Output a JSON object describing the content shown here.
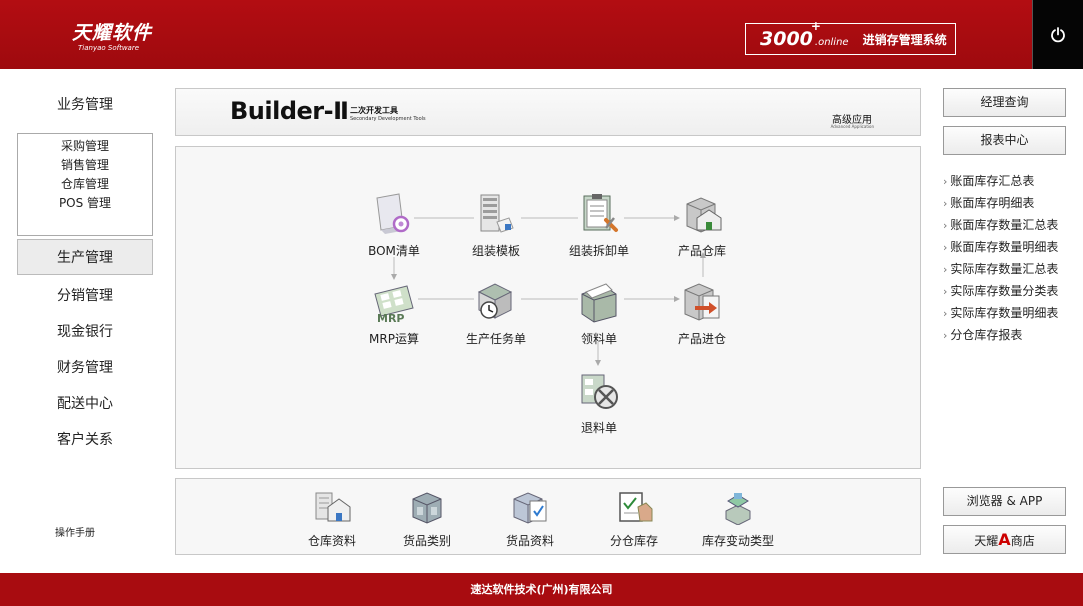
{
  "header": {
    "logo_cn": "天耀软件",
    "logo_en": "Tianyao Software",
    "product_number": "3000",
    "product_plus": "+",
    "product_suffix": ".online",
    "product_name": "进销存管理系统",
    "power_icon": "power-icon"
  },
  "left_nav": {
    "title": "业务管理",
    "sub_items": [
      "采购管理",
      "销售管理",
      "仓库管理",
      "POS 管理"
    ],
    "items": [
      "生产管理",
      "分销管理",
      "现金银行",
      "财务管理",
      "配送中心",
      "客户关系"
    ],
    "active": "生产管理",
    "manual": "操作手册"
  },
  "banner": {
    "title": "Builder-Ⅱ",
    "subtitle_cn": "二次开发工具",
    "subtitle_en": "Secondary Development Tools",
    "advanced": "高级应用",
    "advanced_en": "Advanced Application"
  },
  "flow": {
    "nodes": [
      {
        "label": "BOM清单",
        "icon": "bom-icon"
      },
      {
        "label": "组装模板",
        "icon": "assembly-template-icon"
      },
      {
        "label": "组装拆卸单",
        "icon": "assembly-disassembly-icon"
      },
      {
        "label": "产品仓库",
        "icon": "product-warehouse-icon"
      },
      {
        "label": "MRP运算",
        "icon": "mrp-icon"
      },
      {
        "label": "生产任务单",
        "icon": "production-task-icon"
      },
      {
        "label": "领料单",
        "icon": "material-requisition-icon"
      },
      {
        "label": "产品进仓",
        "icon": "product-inbound-icon"
      },
      {
        "label": "退料单",
        "icon": "material-return-icon"
      }
    ]
  },
  "basics": {
    "items": [
      {
        "label": "仓库资料",
        "icon": "warehouse-data-icon"
      },
      {
        "label": "货品类别",
        "icon": "goods-category-icon"
      },
      {
        "label": "货品资料",
        "icon": "goods-data-icon"
      },
      {
        "label": "分仓库存",
        "icon": "branch-stock-icon"
      },
      {
        "label": "库存变动类型",
        "icon": "stock-change-type-icon"
      }
    ]
  },
  "right": {
    "manager_query": "经理查询",
    "report_center": "报表中心",
    "reports": [
      "账面库存汇总表",
      "账面库存明细表",
      "账面库存数量汇总表",
      "账面库存数量明细表",
      "实际库存数量汇总表",
      "实际库存数量分类表",
      "实际库存数量明细表",
      "分仓库存报表"
    ],
    "browser_app": "浏览器 & APP",
    "store_prefix": "天耀",
    "store_mark": "A",
    "store_suffix": "商店"
  },
  "footer": {
    "company": "速达软件技术(广州)有限公司"
  },
  "colors": {
    "brand_red": "#a80c10",
    "power_bg": "#050505"
  }
}
